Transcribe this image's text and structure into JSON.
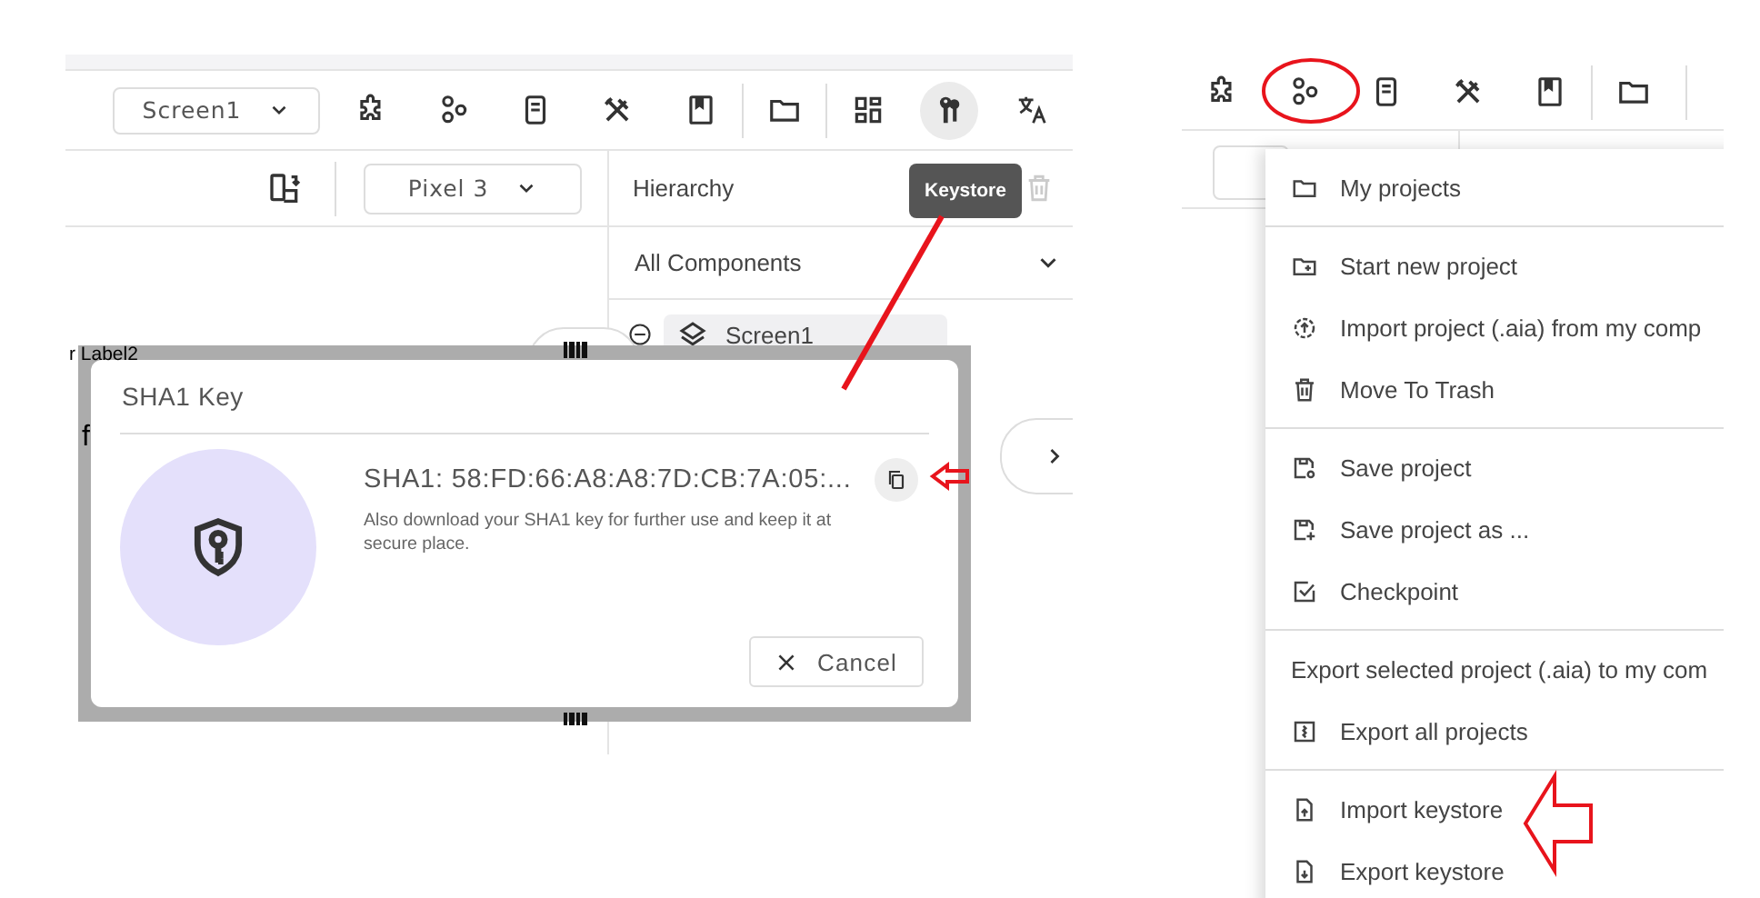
{
  "left_screen": {
    "screen_dropdown": {
      "value": "Screen1"
    },
    "toolbar": [
      {
        "selected": false
      },
      {
        "selected": false
      },
      {
        "selected": false
      },
      {
        "selected": false
      },
      {
        "selected": false
      },
      {
        "selected": false
      },
      {
        "selected": false
      },
      {
        "selected": true
      },
      {
        "selected": false
      }
    ],
    "tooltip": "Keystore",
    "device_dropdown": {
      "value": "Pixel 3"
    },
    "hierarchy": {
      "title": "Hierarchy",
      "filter": "All Components",
      "tree": [
        {
          "label": "Screen1",
          "selected": true,
          "expanded": true
        }
      ]
    },
    "canvas_texts": [
      "r Label2",
      "f"
    ],
    "dialog": {
      "title": "SHA1 Key",
      "sha1": "SHA1: 58:FD:66:A8:A8:7D:CB:7A:05:...",
      "description": "Also download your SHA1 key for further use and keep it at secure place.",
      "cancel": "Cancel"
    }
  },
  "right_screen": {
    "menu": {
      "sections": [
        [
          {
            "label": "My projects"
          }
        ],
        [
          {
            "label": "Start new project"
          },
          {
            "label": "Import project (.aia) from my comp"
          },
          {
            "label": "Move To Trash"
          }
        ],
        [
          {
            "label": "Save project"
          },
          {
            "label": "Save project as ..."
          },
          {
            "label": "Checkpoint"
          }
        ],
        [
          {
            "label": "Export selected project (.aia) to my com"
          },
          {
            "label": "Export all projects"
          }
        ],
        [
          {
            "label": "Import keystore"
          },
          {
            "label": "Export keystore"
          }
        ]
      ]
    }
  }
}
